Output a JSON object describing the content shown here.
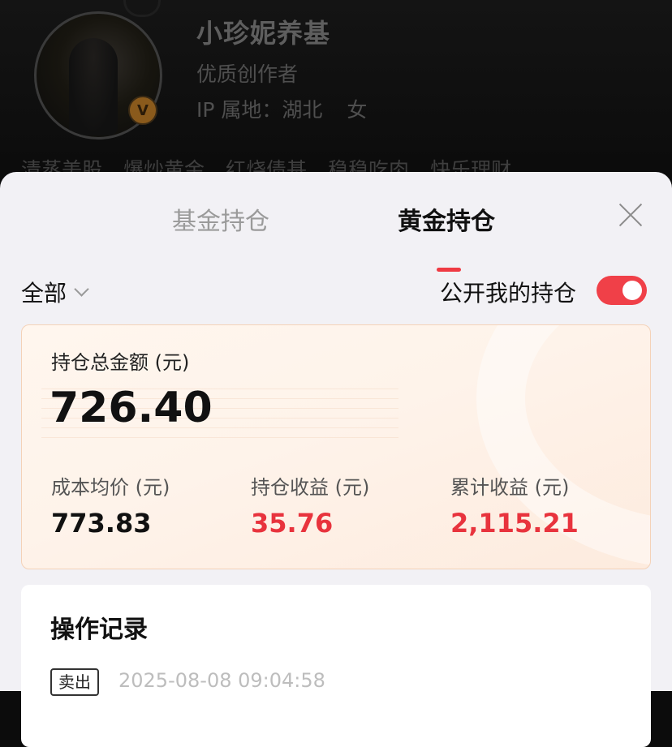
{
  "profile": {
    "name": "小珍妮养基",
    "title": "优质创作者",
    "ip_location": "IP 属地：湖北",
    "gender": "女",
    "verified_badge": "V",
    "tags": [
      "清蒸美股",
      "爆炒黄金",
      "红烧债基",
      "稳稳吃肉",
      "快乐理财"
    ]
  },
  "sheet": {
    "tabs": [
      {
        "label": "基金持仓",
        "active": false
      },
      {
        "label": "黄金持仓",
        "active": true
      }
    ],
    "filter_label": "全部",
    "public_label": "公开我的持仓",
    "public_enabled": true,
    "icons": [
      "close-icon",
      "chevron-down-icon"
    ]
  },
  "summary": {
    "total_label": "持仓总金额 (元)",
    "total_value": "726.40",
    "metrics": [
      {
        "label": "成本均价 (元)",
        "value": "773.83"
      },
      {
        "label": "持仓收益 (元)",
        "value": "35.76"
      },
      {
        "label": "累计收益 (元)",
        "value": "2,115.21"
      }
    ]
  },
  "records": {
    "title": "操作记录",
    "items": [
      {
        "type": "卖出",
        "time": "2025-08-08 09:04:58"
      }
    ]
  },
  "colors": {
    "accent": "#ef3a43",
    "profit": "#e8333d",
    "sheet_bg": "#f2f1f5"
  }
}
